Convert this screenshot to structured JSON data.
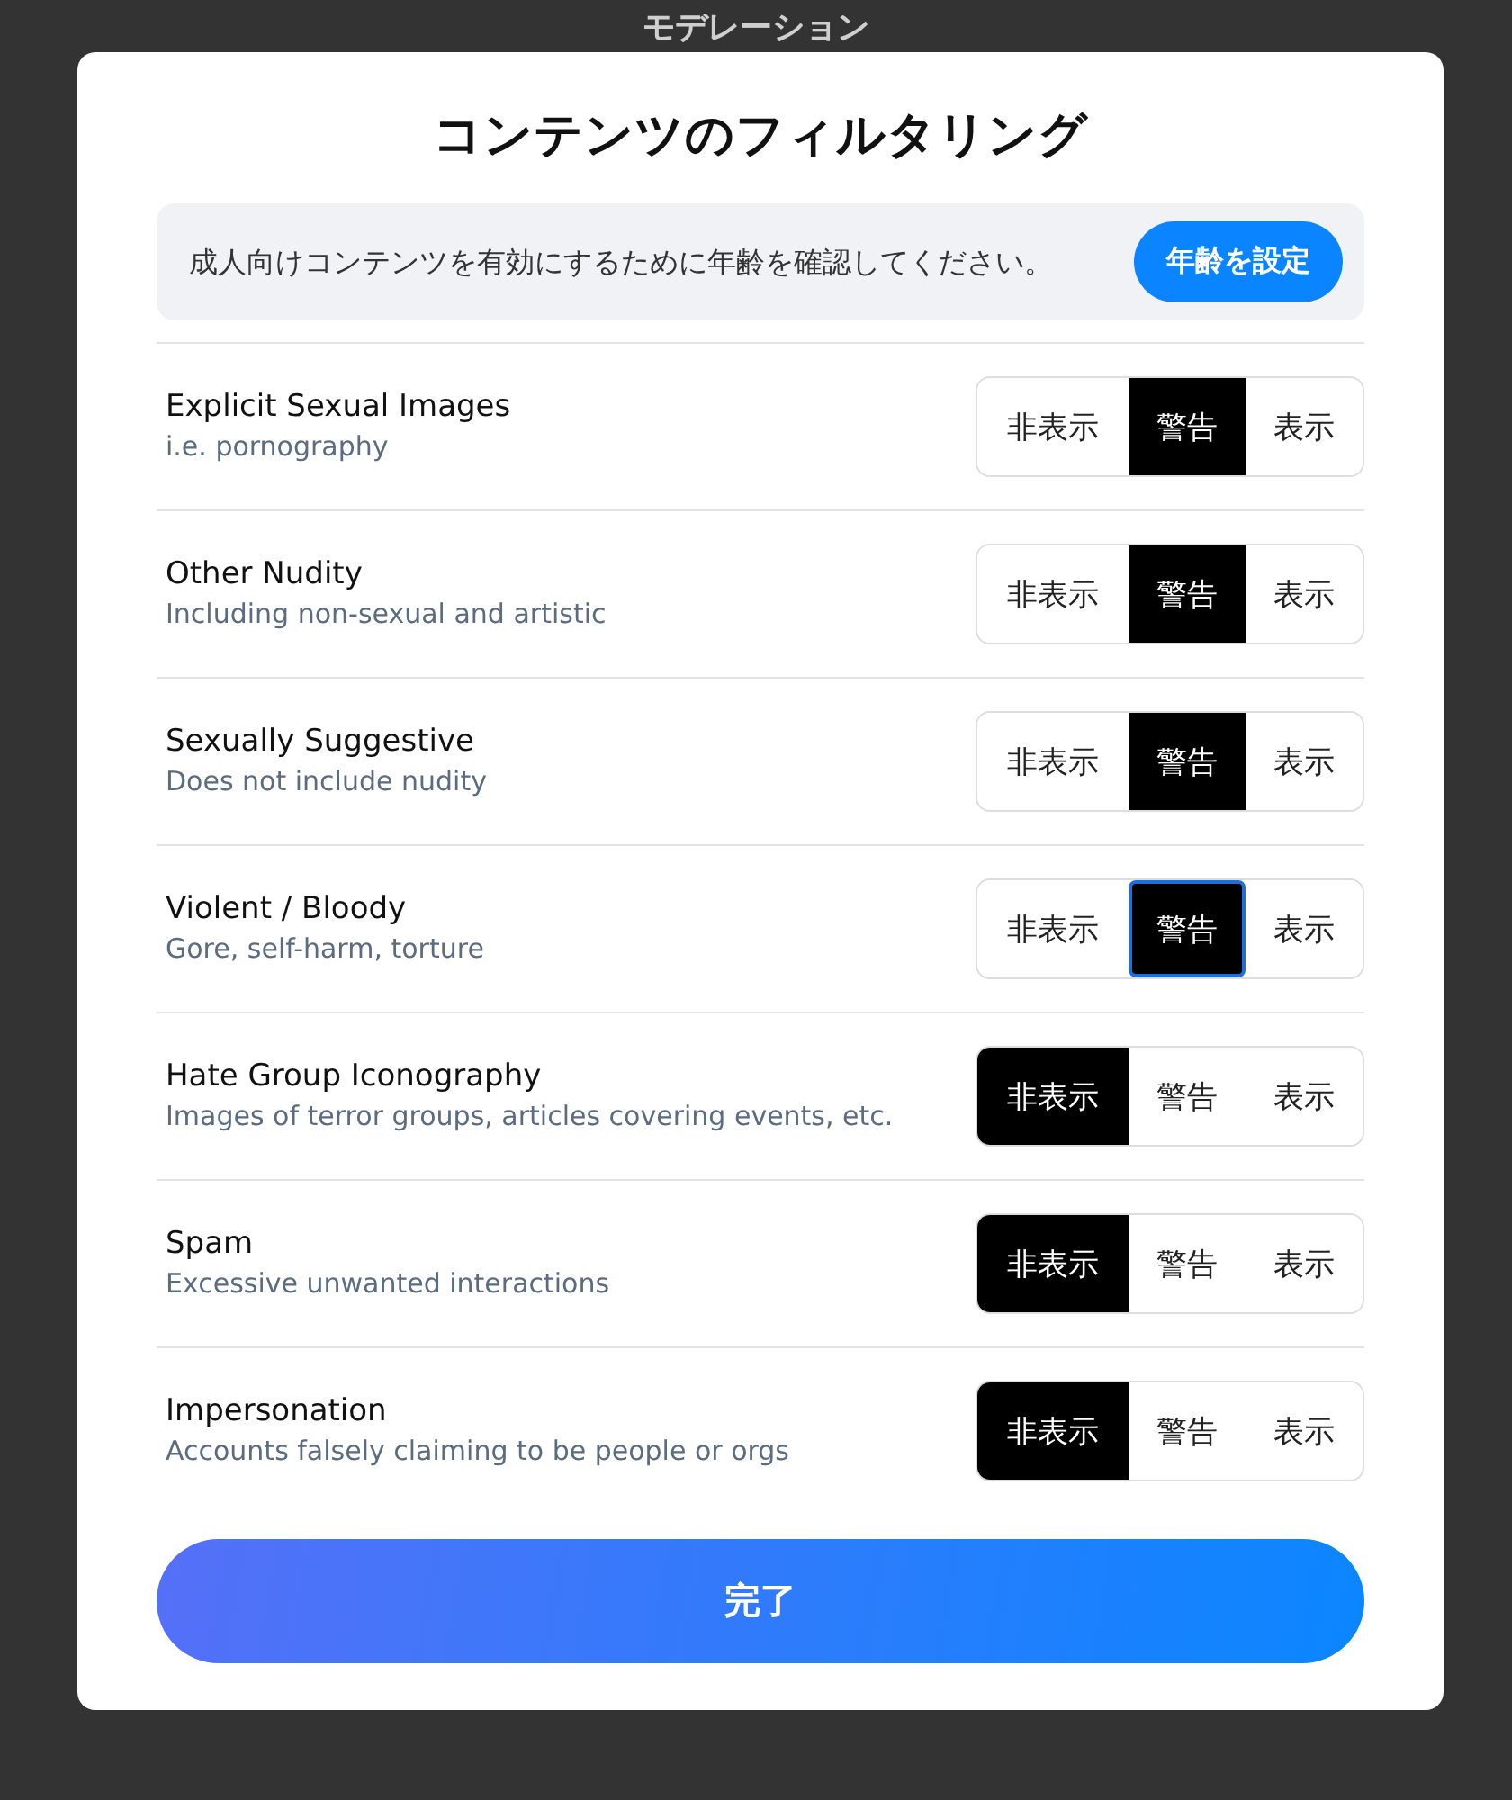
{
  "background_title": "モデレーション",
  "dialog": {
    "title": "コンテンツのフィルタリング",
    "notice": {
      "text": "成人向けコンテンツを有効にするために年齢を確認してください。",
      "button": "年齢を設定"
    },
    "filters": [
      {
        "label": "Explicit Sexual Images",
        "description": "i.e. pornography",
        "options": [
          {
            "label": "非表示",
            "selected": false,
            "focused": false
          },
          {
            "label": "警告",
            "selected": true,
            "focused": false
          },
          {
            "label": "表示",
            "selected": false,
            "focused": false
          }
        ]
      },
      {
        "label": "Other Nudity",
        "description": "Including non-sexual and artistic",
        "options": [
          {
            "label": "非表示",
            "selected": false,
            "focused": false
          },
          {
            "label": "警告",
            "selected": true,
            "focused": false
          },
          {
            "label": "表示",
            "selected": false,
            "focused": false
          }
        ]
      },
      {
        "label": "Sexually Suggestive",
        "description": "Does not include nudity",
        "options": [
          {
            "label": "非表示",
            "selected": false,
            "focused": false
          },
          {
            "label": "警告",
            "selected": true,
            "focused": false
          },
          {
            "label": "表示",
            "selected": false,
            "focused": false
          }
        ]
      },
      {
        "label": "Violent / Bloody",
        "description": "Gore, self-harm, torture",
        "options": [
          {
            "label": "非表示",
            "selected": false,
            "focused": false
          },
          {
            "label": "警告",
            "selected": true,
            "focused": true
          },
          {
            "label": "表示",
            "selected": false,
            "focused": false
          }
        ]
      },
      {
        "label": "Hate Group Iconography",
        "description": "Images of terror groups, articles covering events, etc.",
        "options": [
          {
            "label": "非表示",
            "selected": true,
            "focused": false
          },
          {
            "label": "警告",
            "selected": false,
            "focused": false
          },
          {
            "label": "表示",
            "selected": false,
            "focused": false
          }
        ]
      },
      {
        "label": "Spam",
        "description": "Excessive unwanted interactions",
        "options": [
          {
            "label": "非表示",
            "selected": true,
            "focused": false
          },
          {
            "label": "警告",
            "selected": false,
            "focused": false
          },
          {
            "label": "表示",
            "selected": false,
            "focused": false
          }
        ]
      },
      {
        "label": "Impersonation",
        "description": "Accounts falsely claiming to be people or orgs",
        "options": [
          {
            "label": "非表示",
            "selected": true,
            "focused": false
          },
          {
            "label": "警告",
            "selected": false,
            "focused": false
          },
          {
            "label": "表示",
            "selected": false,
            "focused": false
          }
        ]
      }
    ],
    "done_button": "完了"
  }
}
